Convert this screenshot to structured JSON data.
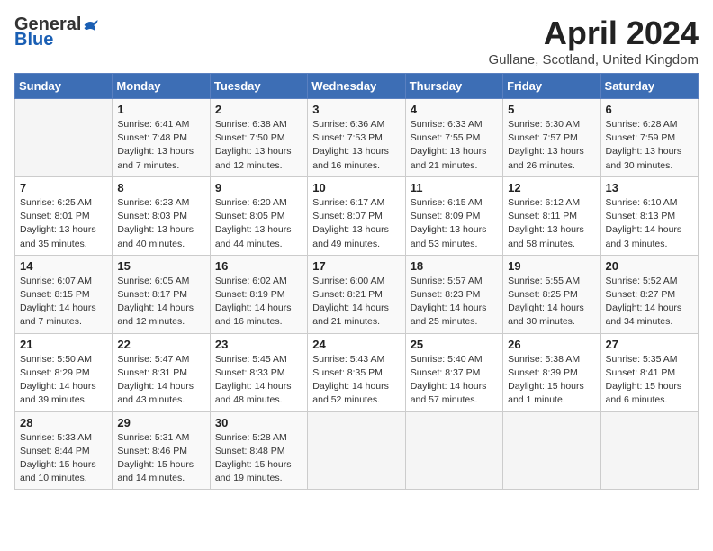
{
  "header": {
    "logo_general": "General",
    "logo_blue": "Blue",
    "title": "April 2024",
    "subtitle": "Gullane, Scotland, United Kingdom"
  },
  "days_of_week": [
    "Sunday",
    "Monday",
    "Tuesday",
    "Wednesday",
    "Thursday",
    "Friday",
    "Saturday"
  ],
  "weeks": [
    [
      {
        "day": "",
        "info": ""
      },
      {
        "day": "1",
        "info": "Sunrise: 6:41 AM\nSunset: 7:48 PM\nDaylight: 13 hours\nand 7 minutes."
      },
      {
        "day": "2",
        "info": "Sunrise: 6:38 AM\nSunset: 7:50 PM\nDaylight: 13 hours\nand 12 minutes."
      },
      {
        "day": "3",
        "info": "Sunrise: 6:36 AM\nSunset: 7:53 PM\nDaylight: 13 hours\nand 16 minutes."
      },
      {
        "day": "4",
        "info": "Sunrise: 6:33 AM\nSunset: 7:55 PM\nDaylight: 13 hours\nand 21 minutes."
      },
      {
        "day": "5",
        "info": "Sunrise: 6:30 AM\nSunset: 7:57 PM\nDaylight: 13 hours\nand 26 minutes."
      },
      {
        "day": "6",
        "info": "Sunrise: 6:28 AM\nSunset: 7:59 PM\nDaylight: 13 hours\nand 30 minutes."
      }
    ],
    [
      {
        "day": "7",
        "info": "Sunrise: 6:25 AM\nSunset: 8:01 PM\nDaylight: 13 hours\nand 35 minutes."
      },
      {
        "day": "8",
        "info": "Sunrise: 6:23 AM\nSunset: 8:03 PM\nDaylight: 13 hours\nand 40 minutes."
      },
      {
        "day": "9",
        "info": "Sunrise: 6:20 AM\nSunset: 8:05 PM\nDaylight: 13 hours\nand 44 minutes."
      },
      {
        "day": "10",
        "info": "Sunrise: 6:17 AM\nSunset: 8:07 PM\nDaylight: 13 hours\nand 49 minutes."
      },
      {
        "day": "11",
        "info": "Sunrise: 6:15 AM\nSunset: 8:09 PM\nDaylight: 13 hours\nand 53 minutes."
      },
      {
        "day": "12",
        "info": "Sunrise: 6:12 AM\nSunset: 8:11 PM\nDaylight: 13 hours\nand 58 minutes."
      },
      {
        "day": "13",
        "info": "Sunrise: 6:10 AM\nSunset: 8:13 PM\nDaylight: 14 hours\nand 3 minutes."
      }
    ],
    [
      {
        "day": "14",
        "info": "Sunrise: 6:07 AM\nSunset: 8:15 PM\nDaylight: 14 hours\nand 7 minutes."
      },
      {
        "day": "15",
        "info": "Sunrise: 6:05 AM\nSunset: 8:17 PM\nDaylight: 14 hours\nand 12 minutes."
      },
      {
        "day": "16",
        "info": "Sunrise: 6:02 AM\nSunset: 8:19 PM\nDaylight: 14 hours\nand 16 minutes."
      },
      {
        "day": "17",
        "info": "Sunrise: 6:00 AM\nSunset: 8:21 PM\nDaylight: 14 hours\nand 21 minutes."
      },
      {
        "day": "18",
        "info": "Sunrise: 5:57 AM\nSunset: 8:23 PM\nDaylight: 14 hours\nand 25 minutes."
      },
      {
        "day": "19",
        "info": "Sunrise: 5:55 AM\nSunset: 8:25 PM\nDaylight: 14 hours\nand 30 minutes."
      },
      {
        "day": "20",
        "info": "Sunrise: 5:52 AM\nSunset: 8:27 PM\nDaylight: 14 hours\nand 34 minutes."
      }
    ],
    [
      {
        "day": "21",
        "info": "Sunrise: 5:50 AM\nSunset: 8:29 PM\nDaylight: 14 hours\nand 39 minutes."
      },
      {
        "day": "22",
        "info": "Sunrise: 5:47 AM\nSunset: 8:31 PM\nDaylight: 14 hours\nand 43 minutes."
      },
      {
        "day": "23",
        "info": "Sunrise: 5:45 AM\nSunset: 8:33 PM\nDaylight: 14 hours\nand 48 minutes."
      },
      {
        "day": "24",
        "info": "Sunrise: 5:43 AM\nSunset: 8:35 PM\nDaylight: 14 hours\nand 52 minutes."
      },
      {
        "day": "25",
        "info": "Sunrise: 5:40 AM\nSunset: 8:37 PM\nDaylight: 14 hours\nand 57 minutes."
      },
      {
        "day": "26",
        "info": "Sunrise: 5:38 AM\nSunset: 8:39 PM\nDaylight: 15 hours\nand 1 minute."
      },
      {
        "day": "27",
        "info": "Sunrise: 5:35 AM\nSunset: 8:41 PM\nDaylight: 15 hours\nand 6 minutes."
      }
    ],
    [
      {
        "day": "28",
        "info": "Sunrise: 5:33 AM\nSunset: 8:44 PM\nDaylight: 15 hours\nand 10 minutes."
      },
      {
        "day": "29",
        "info": "Sunrise: 5:31 AM\nSunset: 8:46 PM\nDaylight: 15 hours\nand 14 minutes."
      },
      {
        "day": "30",
        "info": "Sunrise: 5:28 AM\nSunset: 8:48 PM\nDaylight: 15 hours\nand 19 minutes."
      },
      {
        "day": "",
        "info": ""
      },
      {
        "day": "",
        "info": ""
      },
      {
        "day": "",
        "info": ""
      },
      {
        "day": "",
        "info": ""
      }
    ]
  ]
}
